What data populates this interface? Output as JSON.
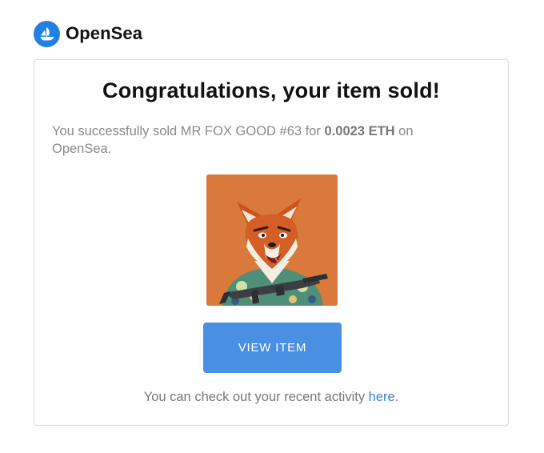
{
  "header": {
    "logo_icon": "opensea-boat-icon",
    "brand_name": "OpenSea",
    "brand_color": "#2081E2"
  },
  "card": {
    "title": "Congratulations, your item sold!",
    "message": {
      "prefix": "You successfully sold MR FOX GOOD #63 for ",
      "amount": "0.0023 ETH",
      "suffix": " on OpenSea."
    },
    "item_image": {
      "icon": "fox-nft-image",
      "background_color": "#d97a3c"
    },
    "view_button": {
      "label": "VIEW ITEM",
      "color": "#4a90e2"
    },
    "activity": {
      "prefix": "You can check out your recent activity ",
      "link_label": "here",
      "suffix": "."
    }
  }
}
